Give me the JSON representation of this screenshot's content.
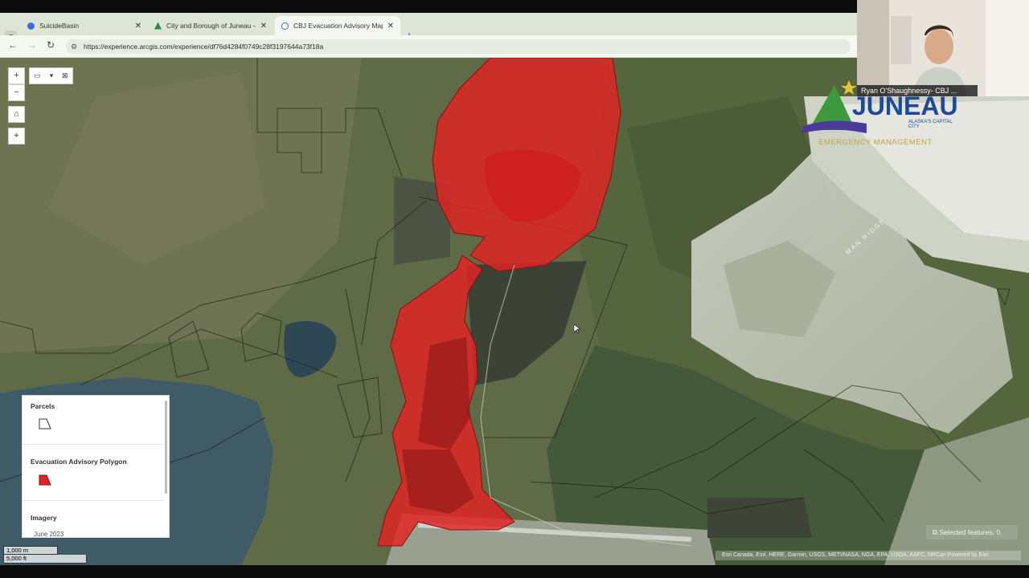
{
  "browser": {
    "tabs": [
      {
        "title": "SuicideBasin",
        "active": false
      },
      {
        "title": "City and Borough of Juneau – A",
        "active": false
      },
      {
        "title": "CBJ Evacuation Advisory Map",
        "active": true
      }
    ],
    "url": "https://experience.arcgis.com/experience/df76d4284f0749c28f3197644a73f18a",
    "new_tab_icon": "plus-icon"
  },
  "map": {
    "ridge_label": "MAN RIDGE",
    "scale_bar": {
      "metric": "1,000 m",
      "imperial": "5,000 ft"
    },
    "selected_features": "Selected features: 0",
    "attribution": "Esri Canada, Esri, HERE, Garmin, USGS, METI/NASA, NGA, EPA, USDA, AAFC, NRCan    Powered by Esri",
    "flood_color": "#e32222"
  },
  "legend": {
    "layers": [
      {
        "title": "Parcels",
        "symbol": "outline-polygon"
      },
      {
        "title": "Evacuation Advisory Polygon",
        "symbol": "red-polygon"
      },
      {
        "title": "Imagery",
        "sublabel": "June 2023"
      }
    ]
  },
  "logo": {
    "word": "JUNEAU",
    "tagline": "ALASKA'S CAPITAL CITY",
    "department": "EMERGENCY MANAGEMENT"
  },
  "webcam": {
    "participant_name": "Ryan O'Shaughnessy- CBJ ..."
  }
}
